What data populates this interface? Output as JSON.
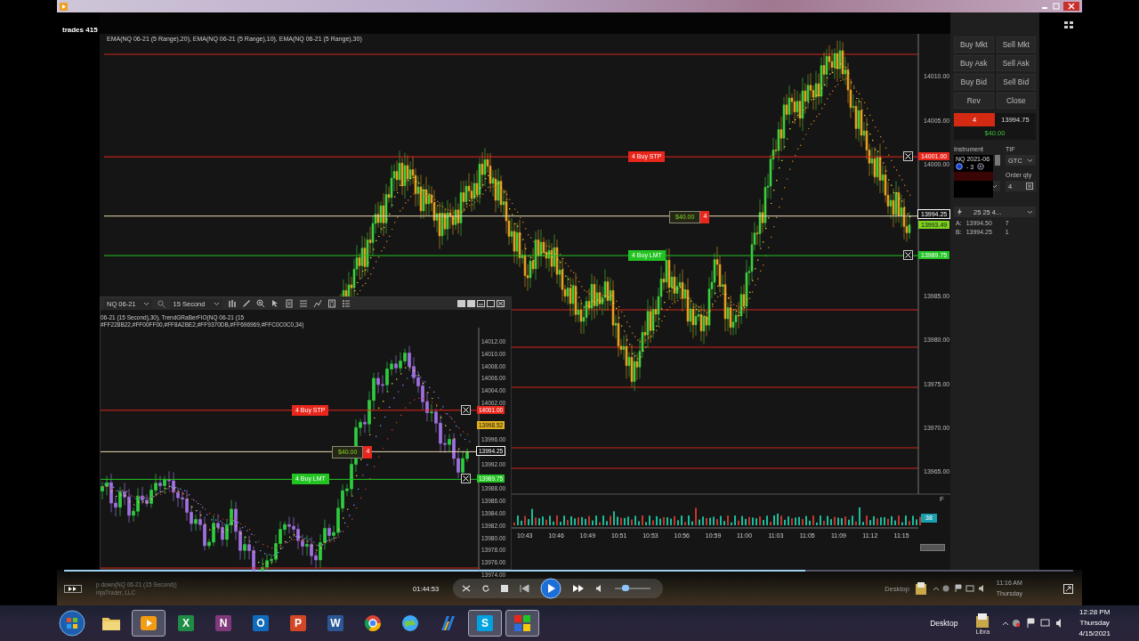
{
  "header": {
    "label": "trades 415"
  },
  "main_chart": {
    "indicators": "EMA(NQ 06-21 (5 Range),20), EMA(NQ 06-21 (5 Range),10), EMA(NQ 06-21 (5 Range),30)",
    "y_labels": [
      "14010.00",
      "14005.00",
      "14000.00",
      "13985.00",
      "13980.00",
      "13975.00",
      "13970.00",
      "13965.00"
    ],
    "tags": [
      {
        "text": "14001.00",
        "color": "#e8261c",
        "order": {
          "kind": "stop",
          "label": "4 Buy STP"
        }
      },
      {
        "text": "13994.25",
        "color": "#111111",
        "order": {
          "kind": "position",
          "label": "$40.00",
          "qty": "4"
        }
      },
      {
        "text": "13993.49",
        "color": "#7ed321"
      },
      {
        "text": "13989.75",
        "color": "#22c322",
        "order": {
          "kind": "limit",
          "label": "4 Buy LMT"
        }
      }
    ],
    "x_labels": [
      "10:43",
      "10:46",
      "10:49",
      "10:51",
      "10:53",
      "10:56",
      "10:59",
      "11:00",
      "11:03",
      "11:05",
      "11:09",
      "11:12",
      "11:15"
    ],
    "volume_tag": "38",
    "panel_label": "F"
  },
  "sub_chart": {
    "instrument": "NQ 06-21",
    "interval": "15 Second",
    "indicators": [
      "06-21 (15 Second),30), TrendGRaBerFIO(NQ 06-21 (15",
      "#FF228B22,#FF00FF00,#FF8A2BE2,#FF9370DB,#FF696969,#FFC0C0C0,34)"
    ],
    "y_labels": [
      "14012.00",
      "14010.00",
      "14008.00",
      "14006.00",
      "14004.00",
      "14002.00",
      "13996.00",
      "13992.00",
      "13988.00",
      "13986.00",
      "13984.00",
      "13982.00",
      "13980.00",
      "13978.00",
      "13976.00",
      "13974.00"
    ],
    "tags": [
      {
        "text": "14001.00",
        "color": "#e8261c",
        "order": {
          "kind": "stop",
          "label": "4 Buy STP"
        }
      },
      {
        "text": "13998.52",
        "color": "#e0b020"
      },
      {
        "text": "13994.25",
        "color": "#111111",
        "order": {
          "kind": "position",
          "label": "$40.00",
          "qty": "4"
        }
      },
      {
        "text": "13989.75",
        "color": "#22c322",
        "order": {
          "kind": "limit",
          "label": "4 Buy LMT"
        }
      }
    ]
  },
  "order_panel": {
    "buttons": [
      "Buy Mkt",
      "Sell Mkt",
      "Buy Ask",
      "Sell Ask",
      "Buy Bid",
      "Sell Bid",
      "Rev",
      "Close"
    ],
    "position": {
      "qty": "4",
      "price": "13994.75",
      "pnl": "$40.00"
    },
    "instrument_label": "Instrument",
    "tif_label": "TIF",
    "tif": "GTC",
    "order_qty_label": "Order qty",
    "order_qty": "4",
    "atm": "25 25 4...",
    "popup": {
      "title": "NQ 2021-06",
      "position": "- 3"
    },
    "ask": {
      "label": "A:",
      "price": "13994.50",
      "size": "7"
    },
    "bid": {
      "label": "B:",
      "price": "13994.25",
      "size": "1"
    }
  },
  "player": {
    "progress": {
      "level": 0.735
    },
    "volume": {
      "level": 0.3
    },
    "time": "01:44:53",
    "caption_lines": [
      "p down(NQ 06-21 (15 Second))",
      "injaTrader, LLC"
    ],
    "overlay": {
      "desktop": "Desktop",
      "clock": "11:16 AM",
      "day": "Thursday"
    }
  },
  "taskbar": {
    "apps": [
      {
        "kind": "folder",
        "selected": false
      },
      {
        "kind": "media",
        "selected": true
      },
      {
        "kind": "letter",
        "glyph": "X",
        "color": "#1e8c45",
        "selected": false
      },
      {
        "kind": "letter",
        "glyph": "N",
        "color": "#80397b",
        "selected": false
      },
      {
        "kind": "letter",
        "glyph": "O",
        "color": "#0f6cbd",
        "selected": false
      },
      {
        "kind": "letter",
        "glyph": "P",
        "color": "#d24726",
        "selected": false
      },
      {
        "kind": "letter",
        "glyph": "W",
        "color": "#2b5797",
        "selected": false
      },
      {
        "kind": "browser",
        "selected": false
      },
      {
        "kind": "globe",
        "selected": false
      },
      {
        "kind": "stripes",
        "selected": false
      },
      {
        "kind": "letter",
        "glyph": "S",
        "color": "#00a3e0",
        "selected": true
      },
      {
        "kind": "tiles",
        "selected": true
      }
    ],
    "desktop": "Desktop",
    "library": "Libra",
    "time": "12:28 PM",
    "day": "Thursday",
    "date": "4/15/2021"
  }
}
